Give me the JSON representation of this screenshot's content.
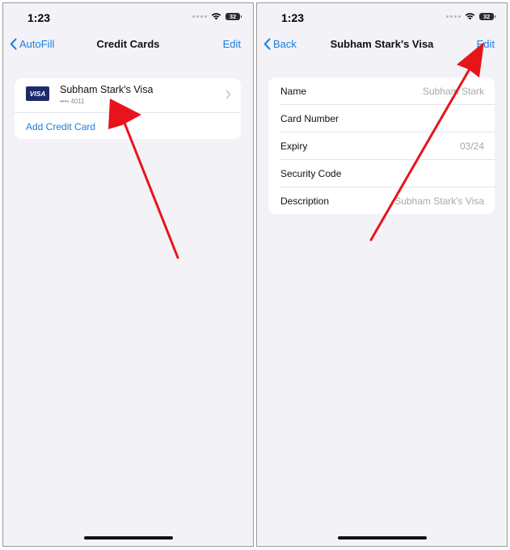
{
  "left": {
    "status": {
      "time": "1:23",
      "battery": "32"
    },
    "nav": {
      "back_label": "AutoFill",
      "title": "Credit Cards",
      "edit_label": "Edit"
    },
    "card": {
      "logo_text": "VISA",
      "name": "Subham Stark's Visa",
      "number": "•••• 4011"
    },
    "add_card_label": "Add Credit Card"
  },
  "right": {
    "status": {
      "time": "1:23",
      "battery": "32"
    },
    "nav": {
      "back_label": "Back",
      "title": "Subham Stark's Visa",
      "edit_label": "Edit"
    },
    "rows": [
      {
        "label": "Name",
        "value": "Subham Stark"
      },
      {
        "label": "Card Number",
        "value": ""
      },
      {
        "label": "Expiry",
        "value": "03/24"
      },
      {
        "label": "Security Code",
        "value": ""
      },
      {
        "label": "Description",
        "value": "Subham Stark's Visa"
      }
    ]
  },
  "colors": {
    "accent": "#1a7fe0",
    "background": "#f2f2f7",
    "annotation_arrow": "#e8141c",
    "visa_blue": "#1b2a6b"
  },
  "icons": [
    "back-chevron-icon",
    "wifi-icon",
    "battery-icon",
    "chevron-right-icon",
    "annotation-arrow-icon"
  ]
}
